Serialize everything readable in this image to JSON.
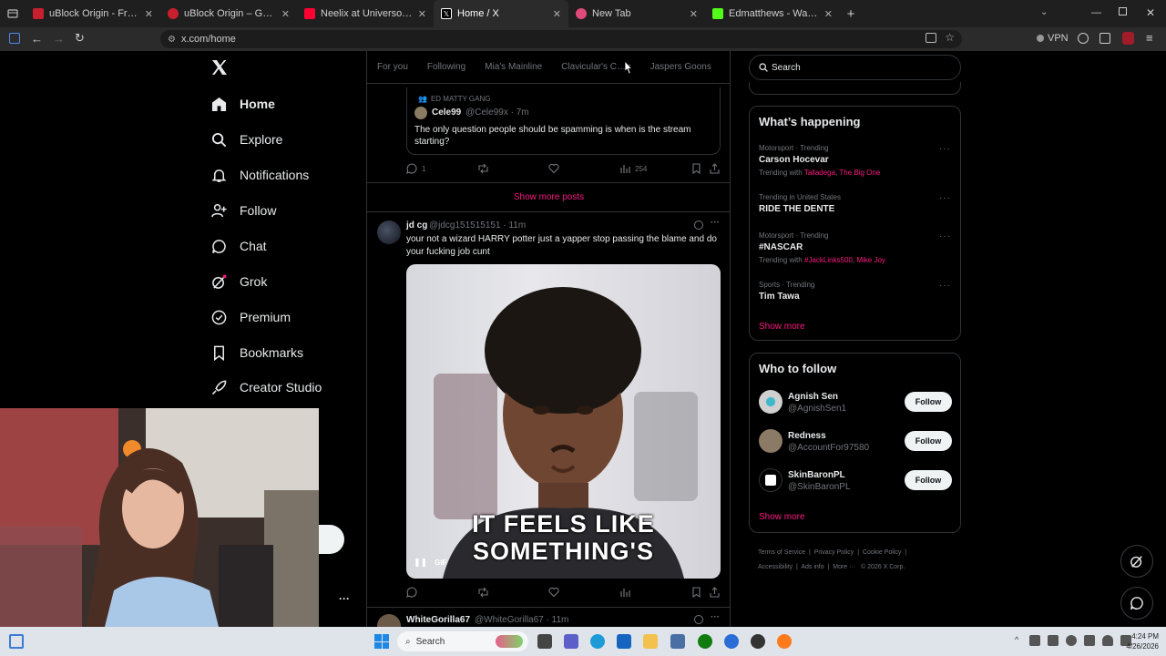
{
  "browser": {
    "tabs": [
      {
        "title": "uBlock Origin - Free, open-sour",
        "color": "#c8202f"
      },
      {
        "title": "uBlock Origin – Get this Extensi",
        "color": "#c8202f"
      },
      {
        "title": "Neelix at Universo Paralello - Yo",
        "color": "#ff0033"
      },
      {
        "title": "Home / X",
        "color": "#000000"
      },
      {
        "title": "New Tab",
        "color": "#e04a7a"
      },
      {
        "title": "Edmatthews - Watch clips on Ki",
        "color": "#53fc18"
      }
    ],
    "url": "x.com/home",
    "vpn_label": "VPN"
  },
  "nav": {
    "items": [
      {
        "label": "Home",
        "icon": "home-icon"
      },
      {
        "label": "Explore",
        "icon": "search-icon"
      },
      {
        "label": "Notifications",
        "icon": "bell-icon"
      },
      {
        "label": "Follow",
        "icon": "add-user-icon"
      },
      {
        "label": "Chat",
        "icon": "chat-icon"
      },
      {
        "label": "Grok",
        "icon": "grok-icon"
      },
      {
        "label": "Premium",
        "icon": "verified-icon"
      },
      {
        "label": "Bookmarks",
        "icon": "bookmark-icon"
      },
      {
        "label": "Creator Studio",
        "icon": "rocket-icon"
      }
    ],
    "more_glyph": "···"
  },
  "feed": {
    "tabs": [
      "For you",
      "Following",
      "Mia's Mainline",
      "Clavicular's C…n",
      "Jaspers Goons"
    ],
    "quote": {
      "community": "ED MATTY GANG",
      "name": "Cele99",
      "handle": "@Cele99x · 7m",
      "text": "The only question people should be spamming is when is the stream starting?"
    },
    "quote_actions": {
      "replies": "1",
      "views": "254"
    },
    "show_more": "Show more posts",
    "post": {
      "name": "jd cg",
      "handle": "@jdcg151515151 · 11m",
      "text": "your not a wizard HARRY potter just a yapper stop passing the blame and do your fucking job cunt",
      "gif_caption_1": "IT FEELS LIKE",
      "gif_caption_2": "SOMETHING'S",
      "gif_badge": "GIF"
    },
    "next_post": {
      "name": "WhiteGorilla67",
      "handle": "@WhiteGorilla67 · 11m"
    }
  },
  "sidebar": {
    "search_placeholder": "Search",
    "happening_title": "What’s happening",
    "trends": [
      {
        "meta": "Motorsport · Trending",
        "name": "Carson Hocevar",
        "with_label": "Trending with",
        "with": [
          "Talladega",
          "The Big One"
        ]
      },
      {
        "meta": "Trending in United States",
        "name": "RIDE THE DENTE"
      },
      {
        "meta": "Motorsport · Trending",
        "name": "#NASCAR",
        "with_label": "Trending with",
        "with": [
          "#JackLinks500",
          "Mike Joy"
        ]
      },
      {
        "meta": "Sports · Trending",
        "name": "Tim Tawa"
      }
    ],
    "show_more": "Show more",
    "wtf_title": "Who to follow",
    "follow_label": "Follow",
    "who_to_follow": [
      {
        "name": "Agnish Sen",
        "handle": "@AgnishSen1"
      },
      {
        "name": "Redness",
        "handle": "@AccountFor97580"
      },
      {
        "name": "SkinBaronPL",
        "handle": "@SkinBaronPL"
      }
    ],
    "wtf_show_more": "Show more",
    "footer": [
      "Terms of Service",
      "Privacy Policy",
      "Cookie Policy",
      "Accessibility",
      "Ads info",
      "More ···",
      "© 2026 X Corp."
    ]
  },
  "taskbar": {
    "search_label": "Search",
    "time": "4:24 PM",
    "date": "4/26/2026"
  },
  "colors": {
    "accent": "#f91880",
    "border": "#2f3336",
    "muted": "#71767b"
  }
}
